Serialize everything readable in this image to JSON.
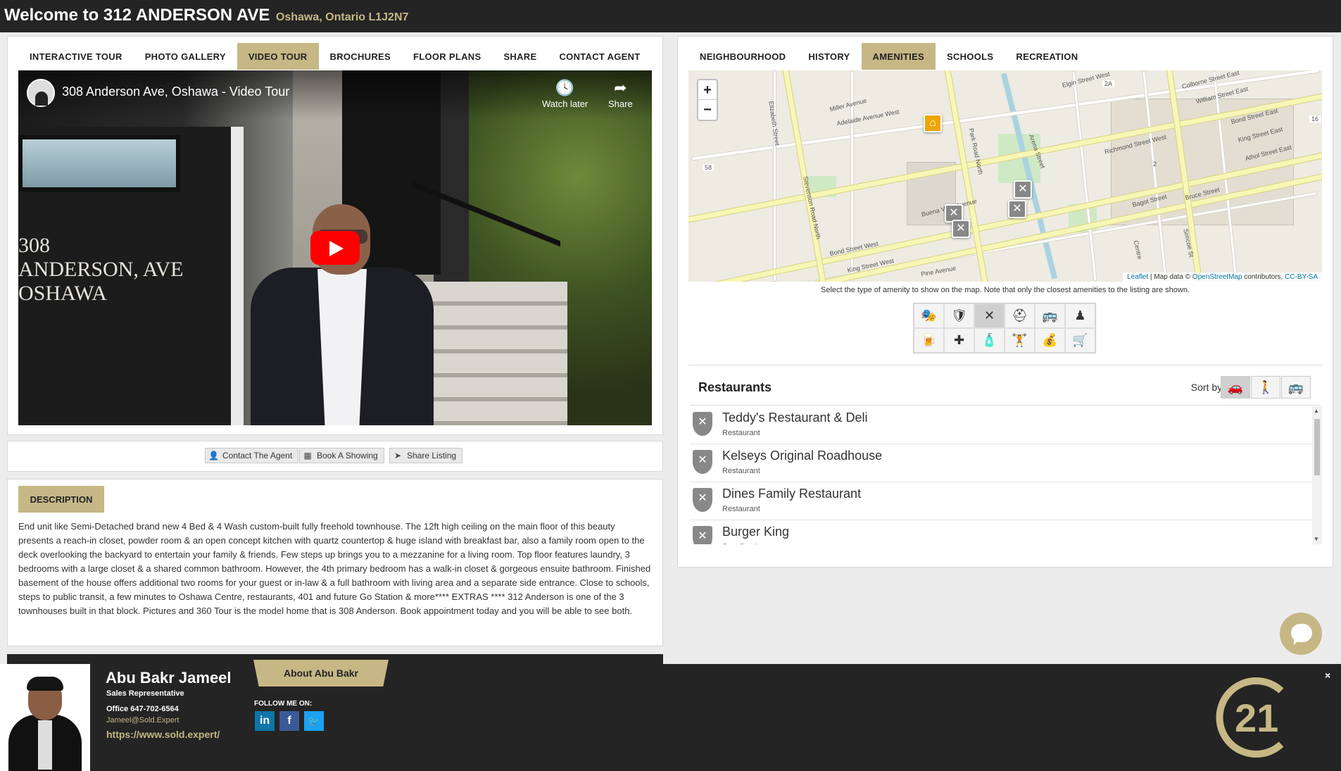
{
  "header": {
    "title": "Welcome to 312 ANDERSON AVE",
    "subtitle": "Oshawa, Ontario L1J2N7"
  },
  "left_tabs": [
    {
      "label": "INTERACTIVE TOUR",
      "active": false
    },
    {
      "label": "PHOTO GALLERY",
      "active": false
    },
    {
      "label": "VIDEO TOUR",
      "active": true
    },
    {
      "label": "BROCHURES",
      "active": false
    },
    {
      "label": "FLOOR PLANS",
      "active": false
    },
    {
      "label": "SHARE",
      "active": false
    },
    {
      "label": "CONTACT AGENT",
      "active": false
    }
  ],
  "video": {
    "title": "308 Anderson Ave, Oshawa - Video Tour",
    "watch_later": "Watch later",
    "share": "Share",
    "overlay_line1": "308",
    "overlay_line2": "ANDERSON, AVE",
    "overlay_line3": "OSHAWA"
  },
  "actions": {
    "contact": "Contact The Agent",
    "book": "Book A Showing",
    "share": "Share Listing"
  },
  "description": {
    "label": "DESCRIPTION",
    "text": "End unit like Semi-Detached brand new 4 Bed & 4 Wash custom-built fully freehold townhouse. The 12ft high ceiling on the main floor of this beauty presents a reach-in closet, powder room & an open concept kitchen with quartz countertop & huge island with breakfast bar, also a family room open to the deck overlooking the backyard to entertain your family & friends. Few steps up brings you to a mezzanine for a living room. Top floor features laundry, 3 bedrooms with a large closet & a shared common bathroom. However, the 4th primary bedroom has a walk-in closet & gorgeous ensuite bathroom. Finished basement of the house offers additional two rooms for your guest or in-law & a full bathroom with living area and a separate side entrance. Close to schools, steps to public transit, a few minutes to Oshawa Centre, restaurants, 401 and future Go Station & more**** EXTRAS **** 312 Anderson is one of the 3 townhouses built in that block. Pictures and 360 Tour is the model home that is 308 Anderson. Book appointment today and you will be able to see both."
  },
  "right_tabs": [
    {
      "label": "NEIGHBOURHOOD",
      "active": false
    },
    {
      "label": "HISTORY",
      "active": false
    },
    {
      "label": "AMENITIES",
      "active": true
    },
    {
      "label": "SCHOOLS",
      "active": false
    },
    {
      "label": "RECREATION",
      "active": false
    }
  ],
  "map": {
    "zoom_in": "+",
    "zoom_out": "−",
    "attribution_leaflet": "Leaflet",
    "attribution_mid": " | Map data © ",
    "attribution_osm": "OpenStreetMap",
    "attribution_tail": " contributors, ",
    "attribution_license": "CC-BY-SA",
    "street_labels": [
      "Adelaide Avenue West",
      "Bond Street West",
      "King Street West",
      "Park Road North",
      "Stevenson Road North",
      "Elizabeth Street",
      "Miller Avenue",
      "Buena Vista Avenue",
      "Bond Street East",
      "King Street East",
      "Athol Street East",
      "Simcoe St",
      "Centre",
      "Bagot Street",
      "Bruce Street",
      "Pine Avenue",
      "Elgin Street West",
      "Colborne Street East",
      "William Street East",
      "Richmond Street West",
      "Arena Street",
      "58",
      "2A",
      "2",
      "16"
    ]
  },
  "amenities": {
    "note": "Select the type of amenity to show on the map. Note that only the closest amenities to the listing are shown.",
    "icons": [
      {
        "name": "theatre-icon",
        "glyph": "🎭",
        "active": false
      },
      {
        "name": "police-icon",
        "glyph": "🛡",
        "active": false
      },
      {
        "name": "restaurant-icon",
        "glyph": "✕",
        "active": true
      },
      {
        "name": "firefighter-icon",
        "glyph": "⛑",
        "active": false
      },
      {
        "name": "bus-icon",
        "glyph": "🚌",
        "active": false
      },
      {
        "name": "bowling-icon",
        "glyph": "♟",
        "active": false
      },
      {
        "name": "beer-icon",
        "glyph": "🍺",
        "active": false
      },
      {
        "name": "medical-icon",
        "glyph": "✚",
        "active": false
      },
      {
        "name": "convenience-icon",
        "glyph": "🧴",
        "active": false
      },
      {
        "name": "fitness-icon",
        "glyph": "🏋",
        "active": false
      },
      {
        "name": "bank-icon",
        "glyph": "💰",
        "active": false
      },
      {
        "name": "shopping-cart-icon",
        "glyph": "🛒",
        "active": false
      }
    ]
  },
  "restaurants": {
    "title": "Restaurants",
    "sort_label": "Sort by:",
    "items": [
      {
        "name": "Teddy's Restaurant & Deli",
        "type": "Restaurant"
      },
      {
        "name": "Kelseys Original Roadhouse",
        "type": "Restaurant"
      },
      {
        "name": "Dines Family Restaurant",
        "type": "Restaurant"
      },
      {
        "name": "Burger King",
        "type": "Fast Food"
      }
    ]
  },
  "agent": {
    "name": "Abu Bakr Jameel",
    "role": "Sales Representative",
    "office": "Office 647-702-6564",
    "email": "Jameel@Sold.Expert",
    "website": "https://www.sold.expert/",
    "about_button": "About Abu Bakr",
    "follow": "FOLLOW ME ON:",
    "social": [
      {
        "name": "linkedin-icon",
        "glyph": "in",
        "color": "#0e76a8"
      },
      {
        "name": "facebook-icon",
        "glyph": "f",
        "color": "#3b5998"
      },
      {
        "name": "twitter-icon",
        "glyph": "🐦",
        "color": "#1da1f2"
      }
    ],
    "close": "×",
    "logo_text": "21"
  },
  "colors": {
    "accent": "#c6b785",
    "dark": "#242424"
  }
}
